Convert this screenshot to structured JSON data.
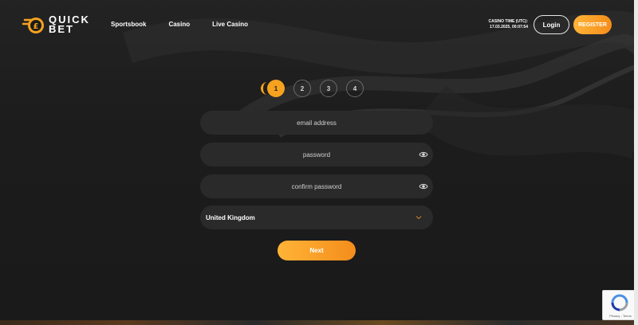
{
  "brand": {
    "line1": "QUICK",
    "line2": "BET",
    "accent": "#f6a21f"
  },
  "nav": [
    {
      "label": "Sportsbook"
    },
    {
      "label": "Casino"
    },
    {
      "label": "Live Casino"
    }
  ],
  "casino_time": {
    "label": "CASINO TIME (UTC):",
    "value": "17.03.2025, 00:07:54"
  },
  "header_buttons": {
    "login": "Login",
    "register": "REGISTER"
  },
  "steps": [
    {
      "number": "1",
      "active": true
    },
    {
      "number": "2",
      "active": false
    },
    {
      "number": "3",
      "active": false
    },
    {
      "number": "4",
      "active": false
    }
  ],
  "form": {
    "email": {
      "placeholder": "email address",
      "value": ""
    },
    "password": {
      "placeholder": "password",
      "value": ""
    },
    "confirm_password": {
      "placeholder": "confirm password",
      "value": ""
    },
    "country": {
      "selected": "United Kingdom"
    },
    "next_label": "Next"
  },
  "recaptcha": {
    "links": "Privacy - Terms"
  },
  "icons": [
    "logo-icon",
    "eye-icon",
    "chevron-down-icon",
    "recaptcha-icon"
  ]
}
